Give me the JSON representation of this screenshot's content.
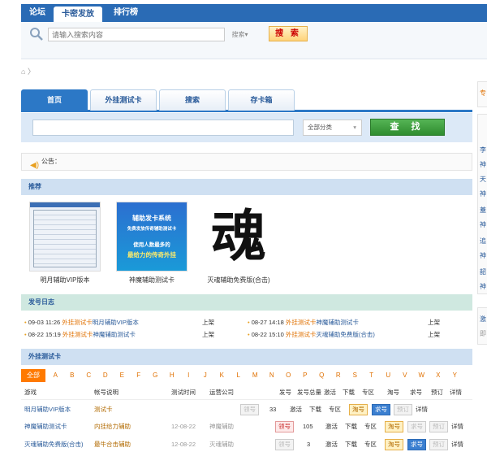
{
  "topnav": [
    {
      "label": "论坛",
      "active": false
    },
    {
      "label": "卡密发放",
      "active": true
    },
    {
      "label": "排行榜",
      "active": false
    }
  ],
  "search": {
    "placeholder": "请输入搜索内容",
    "scope": "搜索",
    "button": "搜 索"
  },
  "tabs": [
    {
      "label": "首页",
      "active": true
    },
    {
      "label": "外挂测试卡",
      "active": false
    },
    {
      "label": "搜索",
      "active": false
    },
    {
      "label": "存卡箱",
      "active": false
    }
  ],
  "tab_search": {
    "category": "全部分类",
    "button": "查 找"
  },
  "notice": {
    "label": "公告："
  },
  "recommend": {
    "title": "推荐",
    "items": [
      {
        "caption": "明月辅助VIP版本"
      },
      {
        "caption": "神魔辅助测试卡"
      },
      {
        "caption": "灭魂辅助免费版(合击)"
      }
    ],
    "banner_texts": [
      "辅助发卡系统",
      "免费发放传奇辅助测试卡",
      "使用人数最多的",
      "最给力的传奇外挂"
    ],
    "calligraphy": "魂"
  },
  "log": {
    "title": "发号日志",
    "entries": [
      {
        "date": "09-03 11:26",
        "tag": "外挂测试卡",
        "name": "明月辅助VIP版本",
        "status": "上架"
      },
      {
        "date": "08-27 14:18",
        "tag": "外挂测试卡",
        "name": "神魔辅助测试卡",
        "status": "上架"
      },
      {
        "date": "08-22 15:19",
        "tag": "外挂测试卡",
        "name": "神魔辅助测试卡",
        "status": "上架"
      },
      {
        "date": "08-22 15:10",
        "tag": "外挂测试卡",
        "name": "灭魂辅助免费版(合击)",
        "status": "上架"
      }
    ]
  },
  "testcards": {
    "title": "外挂测试卡",
    "letters": [
      "全部",
      "A",
      "B",
      "C",
      "D",
      "E",
      "F",
      "G",
      "H",
      "I",
      "J",
      "K",
      "L",
      "M",
      "N",
      "O",
      "P",
      "Q",
      "R",
      "S",
      "T",
      "U",
      "V",
      "W",
      "X",
      "Y"
    ],
    "headers": {
      "game": "游戏",
      "desc": "帐号说明",
      "time": "测试时间",
      "op": "运营公司",
      "issued": "发号",
      "total": "发号总量",
      "activate": "激活",
      "download": "下载",
      "zone": "专区",
      "tao": "淘号",
      "seek": "求号",
      "reserve": "预订",
      "detail": "详情"
    },
    "rows": [
      {
        "game": "明月辅助VIP版本",
        "desc": "测试卡",
        "time": "",
        "op": "",
        "issue_btn": "领号",
        "count": "33",
        "activate": "激活",
        "download": "下载",
        "zone": "专区",
        "tao": "淘号",
        "seek": "求号",
        "reserve": "预订",
        "detail": "详情"
      },
      {
        "game": "神魔辅助测试卡",
        "desc": "内挂给力辅助",
        "time": "12-08-22",
        "op": "神魔辅助",
        "issue_btn": "领号",
        "count": "105",
        "activate": "激活",
        "download": "下载",
        "zone": "专区",
        "tao": "淘号",
        "seek": "求号",
        "reserve": "预订",
        "detail": "详情"
      },
      {
        "game": "灭魂辅助免费版(合击)",
        "desc": "最牛合击辅助",
        "time": "12-08-22",
        "op": "灭魂辅助",
        "issue_btn": "领号",
        "count": "3",
        "activate": "激活",
        "download": "下载",
        "zone": "专区",
        "tao": "淘号",
        "seek": "求号",
        "reserve": "预订",
        "detail": "详情"
      }
    ]
  },
  "sidebar_glyphs": [
    "专",
    "李",
    "神",
    "天",
    "神",
    "蓋",
    "神",
    "追",
    "神",
    "韶",
    "神",
    "激",
    "即"
  ],
  "colors": {
    "brand_blue": "#2a6bb5",
    "accent_orange": "#e07000",
    "find_green": "#3a9a3a"
  }
}
